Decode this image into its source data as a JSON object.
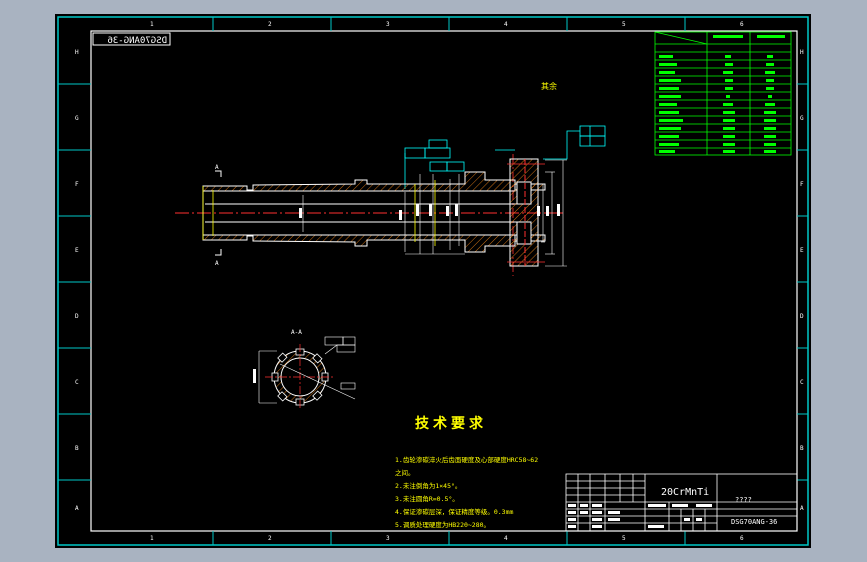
{
  "drawing": {
    "code_mirrored": "DSG70ANG-36",
    "code": "DSG70ANG-36",
    "material": "20CrMnTi",
    "part_name": "????",
    "section_label": "A-A",
    "section_mark_top": "A",
    "section_mark_bottom": "A",
    "roughness_other": "其余",
    "tech_title": "技术要求",
    "tech_notes": [
      "1.齿轮渗碳淬火后齿面硬度及心部硬度HRC58~62",
      "之间。",
      "2.未注倒角为1×45°。",
      "3.未注圆角R=0.5°。",
      "4.保证渗碳层深，保证精度等级。0.3mm",
      "5.调质处理硬度为HB220~280。"
    ]
  },
  "zone_numbers": [
    "1",
    "2",
    "3",
    "4",
    "5",
    "6"
  ],
  "zone_letters": [
    "A",
    "B",
    "C",
    "D",
    "E",
    "F",
    "G",
    "H"
  ]
}
